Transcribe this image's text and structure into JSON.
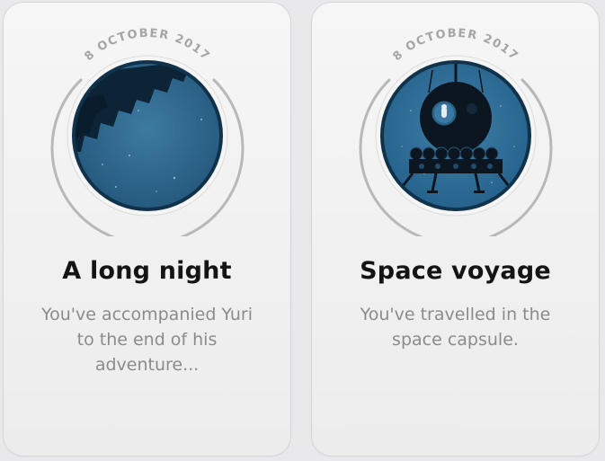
{
  "achievements": [
    {
      "date_label": "8 OCTOBER 2017",
      "title": "A long night",
      "description_lines": [
        "You've accompanied Yuri",
        "to the end of his",
        "adventure..."
      ],
      "icon": "crescent-moon-icon"
    },
    {
      "date_label": "8 OCTOBER 2017",
      "title": "Space voyage",
      "description_lines": [
        "You've travelled in the",
        "space capsule."
      ],
      "icon": "space-capsule-icon"
    }
  ],
  "colors": {
    "badge_blue": "#2e6489",
    "badge_dark_rim": "#10324a",
    "ring_gray": "#b7b7b9",
    "date_gray": "#a5a5a7",
    "title": "#141414",
    "description": "#8b8b8d"
  }
}
